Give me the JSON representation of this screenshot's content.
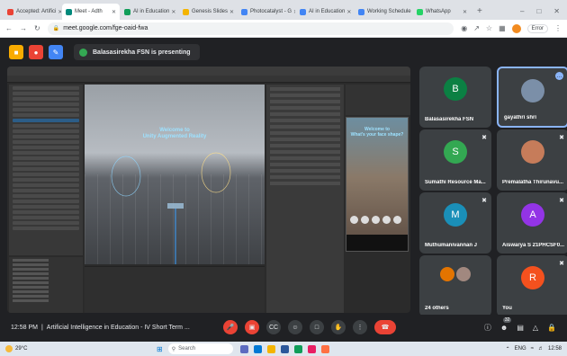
{
  "browser": {
    "tabs": [
      {
        "title": "Accepted: Artifici",
        "color": "#ea4335",
        "active": false
      },
      {
        "title": "Meet - Adth",
        "color": "#00897b",
        "active": true
      },
      {
        "title": "AI in Education",
        "color": "#0f9d58",
        "active": false
      },
      {
        "title": "Genesis Slides",
        "color": "#f4b400",
        "active": false
      },
      {
        "title": "Photocatalyst - G",
        "color": "#4285f4",
        "active": false
      },
      {
        "title": "AI in Education",
        "color": "#4285f4",
        "active": false
      },
      {
        "title": "Working Schedule",
        "color": "#4285f4",
        "active": false
      },
      {
        "title": "WhatsApp",
        "color": "#25d366",
        "active": false
      }
    ],
    "new_tab": "+",
    "url": "meet.google.com/fge-oaid-fwa",
    "edit_button": "Error"
  },
  "presenter": {
    "banner": "Balasasirekha FSN is presenting"
  },
  "shared_screen": {
    "scene_text_line1": "Welcome to",
    "scene_text_line2": "Unity Augmented Reality",
    "phone_text_line1": "Welcome to",
    "phone_text_line2": "What's your face shape?"
  },
  "participants": [
    {
      "name": "Balasasirekha FSN",
      "initial": "B",
      "color": "#0b8043",
      "muted": false
    },
    {
      "name": "gayathri shri",
      "initial": "",
      "color": "#7b8fa8",
      "muted": false,
      "active": true
    },
    {
      "name": "Sumathi Resource Ma...",
      "initial": "S",
      "color": "#33a852",
      "muted": true
    },
    {
      "name": "Premalatha Thirunavu...",
      "initial": "",
      "color": "#c67c5a",
      "muted": true
    },
    {
      "name": "Muthumanivannan J",
      "initial": "M",
      "color": "#1a8fb8",
      "muted": true
    },
    {
      "name": "Aiswarya S 21PHCSF0...",
      "initial": "A",
      "color": "#9334e6",
      "muted": true
    },
    {
      "name": "24 others",
      "initial": "",
      "color": "#e37400",
      "muted": false
    },
    {
      "name": "You",
      "initial": "R",
      "color": "#f4511e",
      "muted": true
    }
  ],
  "meeting": {
    "time": "12:58 PM",
    "separator": "|",
    "title": "Artificial Intelligence in Education - IV Short Term ...",
    "participant_count": "32"
  },
  "taskbar": {
    "temperature": "29°C",
    "search_placeholder": "Search",
    "language": "ENG",
    "clock": "12:58"
  }
}
